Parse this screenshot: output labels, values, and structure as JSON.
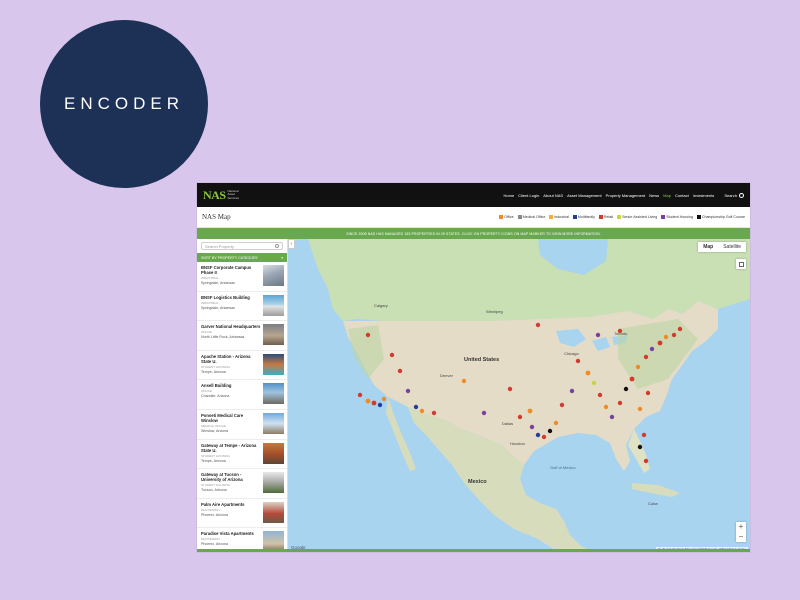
{
  "brand": {
    "label": "ENCODER",
    "circle_color": "#1d3055",
    "background": "#d9c6ec"
  },
  "site": {
    "logo": {
      "mark": "NAS",
      "sub": "National Asset Services"
    },
    "nav": [
      "Home",
      "Client Login",
      "About NAS",
      "Asset Management",
      "Property Management",
      "News",
      "Map",
      "Contact",
      "Investments"
    ],
    "nav_active": "Map",
    "search_label": "Search",
    "accent": "#6aa84f"
  },
  "map_page": {
    "title": "NAS Map",
    "legend": [
      {
        "label": "Office",
        "color": "#f08a24"
      },
      {
        "label": "Medical Office",
        "color": "#888888"
      },
      {
        "label": "Industrial",
        "color": "#f2b134"
      },
      {
        "label": "Multifamily",
        "color": "#1f3f9e"
      },
      {
        "label": "Retail",
        "color": "#d33a2c"
      },
      {
        "label": "Senior Assisted Living",
        "color": "#c8d63a"
      },
      {
        "label": "Student Housing",
        "color": "#7b3fa0"
      },
      {
        "label": "Championship Golf Course",
        "color": "#111111"
      }
    ],
    "banner": "SINCE 2008 NAS HAS MANAGED 153 PROPERTIES IN 29 STATES. CLICK ON PROPERTY ICONS ON MAP MARKER TO VIEW MORE INFORMATION."
  },
  "sidebar": {
    "search_placeholder": "Search Property",
    "category_label": "SORT BY PROPERTY CATEGORY",
    "properties": [
      {
        "name": "BNSF Corporate Campus Phase II",
        "category": "Industrial",
        "location": "Springdale, Arkansas"
      },
      {
        "name": "BNSF Logistics Building",
        "category": "Industrial",
        "location": "Springdale, Arkansas"
      },
      {
        "name": "Garver National Headquarters",
        "category": "Office",
        "location": "North Little Rock, Arkansas"
      },
      {
        "name": "Apache Station - Arizona State U.",
        "category": "Student Housing",
        "location": "Tempe, Arizona"
      },
      {
        "name": "Ansell Building",
        "category": "Office",
        "location": "Chandler, Arizona"
      },
      {
        "name": "Ponseti Medical Care Winslow",
        "category": "Medical Office",
        "location": "Winslow, Arizona"
      },
      {
        "name": "Gateway at Tempe - Arizona State U.",
        "category": "Student Housing",
        "location": "Tempe, Arizona"
      },
      {
        "name": "Gateway at Tucson - University of Arizona",
        "category": "Student Housing",
        "location": "Tucson, Arizona"
      },
      {
        "name": "Palm Aire Apartments",
        "category": "Multifamily",
        "location": "Phoenix, Arizona"
      },
      {
        "name": "Paradise Vista Apartments",
        "category": "Multifamily",
        "location": "Phoenix, Arizona"
      }
    ]
  },
  "map": {
    "type_buttons": [
      "Map",
      "Satellite"
    ],
    "type_active": "Map",
    "labels": [
      "United States",
      "Mexico",
      "Calgary",
      "Winnipeg",
      "Denver",
      "Dallas",
      "Houston",
      "Chicago",
      "Toronto",
      "Gulf of Mexico",
      "Cuba"
    ],
    "google": "Google",
    "attribution": "Keyboard shortcuts   Map data ©2022 Google, INEGI   Terms of Use",
    "zoom_in": "+",
    "zoom_out": "−"
  }
}
